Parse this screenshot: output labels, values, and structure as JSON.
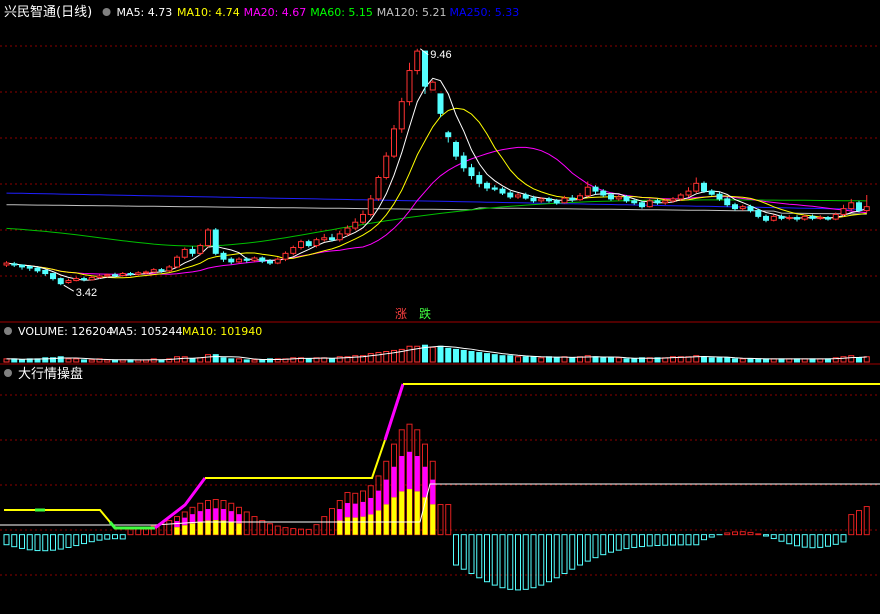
{
  "header": {
    "stock_name": "兴民智通",
    "period": "(日线)",
    "ma_values": [
      {
        "label": "MA5: 4.73",
        "color": "#ffffff"
      },
      {
        "label": "MA10: 4.74",
        "color": "#ffff00"
      },
      {
        "label": "MA20: 4.67",
        "color": "#ff00ff"
      },
      {
        "label": "MA60: 5.15",
        "color": "#00ff00"
      },
      {
        "label": "MA120: 5.21",
        "color": "#c0c0c0"
      },
      {
        "label": "MA250: 5.33",
        "color": "#0000ff"
      }
    ]
  },
  "volume_header": {
    "items": [
      {
        "label": "VOLUME: 126204",
        "color": "#ffffff"
      },
      {
        "label": "MA5: 105244",
        "color": "#ffffff"
      },
      {
        "label": "MA10: 101940",
        "color": "#ffff00"
      }
    ]
  },
  "indicator_header": {
    "title": "大行情操盘"
  },
  "badges": {
    "up": "涨",
    "down": "跌"
  },
  "annotations": {
    "high": "9.46",
    "low": "3.42"
  },
  "colors": {
    "up": "#ff3232",
    "down": "#54ffff",
    "ma5": "#ffffff",
    "ma10": "#ffff00",
    "ma20": "#ff00ff",
    "ma60": "#00c000",
    "ma120": "#c0c0c0",
    "ma250": "#2020ff",
    "grid": "#8b0000"
  },
  "chart_data": {
    "type": "candlestick",
    "price_range": [
      3.0,
      10.2
    ],
    "candles": [
      [
        3.9,
        3.95,
        3.85,
        4.0
      ],
      [
        3.93,
        3.9,
        3.85,
        3.98
      ],
      [
        3.9,
        3.85,
        3.78,
        3.92
      ],
      [
        3.86,
        3.82,
        3.75,
        3.88
      ],
      [
        3.82,
        3.75,
        3.7,
        3.85
      ],
      [
        3.76,
        3.68,
        3.62,
        3.78
      ],
      [
        3.68,
        3.55,
        3.5,
        3.7
      ],
      [
        3.55,
        3.42,
        3.38,
        3.58
      ],
      [
        3.45,
        3.5,
        3.42,
        3.55
      ],
      [
        3.5,
        3.55,
        3.48,
        3.6
      ],
      [
        3.55,
        3.52,
        3.48,
        3.6
      ],
      [
        3.52,
        3.58,
        3.5,
        3.62
      ],
      [
        3.58,
        3.62,
        3.55,
        3.66
      ],
      [
        3.62,
        3.65,
        3.58,
        3.68
      ],
      [
        3.65,
        3.63,
        3.58,
        3.7
      ],
      [
        3.63,
        3.68,
        3.6,
        3.72
      ],
      [
        3.68,
        3.66,
        3.62,
        3.72
      ],
      [
        3.66,
        3.7,
        3.63,
        3.74
      ],
      [
        3.7,
        3.72,
        3.66,
        3.76
      ],
      [
        3.72,
        3.78,
        3.7,
        3.82
      ],
      [
        3.78,
        3.75,
        3.7,
        3.82
      ],
      [
        3.75,
        3.85,
        3.72,
        3.9
      ],
      [
        3.85,
        4.1,
        3.82,
        4.15
      ],
      [
        4.1,
        4.3,
        4.05,
        4.35
      ],
      [
        4.3,
        4.2,
        4.12,
        4.38
      ],
      [
        4.2,
        4.4,
        4.15,
        4.45
      ],
      [
        4.4,
        4.8,
        4.35,
        4.85
      ],
      [
        4.8,
        4.2,
        4.15,
        4.85
      ],
      [
        4.2,
        4.05,
        3.98,
        4.25
      ],
      [
        4.05,
        3.98,
        3.92,
        4.1
      ],
      [
        3.98,
        4.05,
        3.95,
        4.1
      ],
      [
        4.05,
        4.02,
        3.96,
        4.1
      ],
      [
        4.02,
        4.08,
        3.98,
        4.12
      ],
      [
        4.08,
        4.0,
        3.95,
        4.12
      ],
      [
        4.0,
        3.95,
        3.9,
        4.05
      ],
      [
        3.95,
        4.05,
        3.92,
        4.1
      ],
      [
        4.05,
        4.2,
        4.0,
        4.25
      ],
      [
        4.2,
        4.35,
        4.15,
        4.4
      ],
      [
        4.35,
        4.5,
        4.3,
        4.55
      ],
      [
        4.5,
        4.4,
        4.35,
        4.55
      ],
      [
        4.4,
        4.55,
        4.35,
        4.6
      ],
      [
        4.55,
        4.6,
        4.5,
        4.7
      ],
      [
        4.6,
        4.55,
        4.5,
        4.7
      ],
      [
        4.55,
        4.7,
        4.5,
        4.78
      ],
      [
        4.7,
        4.85,
        4.65,
        4.92
      ],
      [
        4.85,
        5.0,
        4.8,
        5.1
      ],
      [
        5.0,
        5.2,
        4.95,
        5.3
      ],
      [
        5.2,
        5.6,
        5.15,
        5.7
      ],
      [
        5.6,
        6.15,
        5.55,
        6.2
      ],
      [
        6.15,
        6.7,
        6.1,
        6.8
      ],
      [
        6.7,
        7.4,
        6.65,
        7.5
      ],
      [
        7.4,
        8.1,
        7.3,
        8.2
      ],
      [
        8.1,
        8.9,
        8.0,
        9.1
      ],
      [
        8.9,
        9.4,
        8.8,
        9.46
      ],
      [
        9.4,
        8.5,
        8.3,
        9.4
      ],
      [
        8.4,
        8.6,
        8.4,
        8.65
      ],
      [
        8.3,
        7.8,
        7.7,
        8.0
      ],
      [
        7.3,
        7.2,
        7.05,
        7.35
      ],
      [
        7.05,
        6.7,
        6.6,
        7.1
      ],
      [
        6.7,
        6.4,
        6.3,
        6.8
      ],
      [
        6.4,
        6.2,
        6.1,
        6.5
      ],
      [
        6.2,
        6.0,
        5.9,
        6.3
      ],
      [
        6.0,
        5.88,
        5.8,
        6.05
      ],
      [
        5.88,
        5.85,
        5.8,
        5.95
      ],
      [
        5.85,
        5.75,
        5.7,
        5.9
      ],
      [
        5.75,
        5.65,
        5.6,
        5.8
      ],
      [
        5.65,
        5.7,
        5.6,
        5.75
      ],
      [
        5.7,
        5.62,
        5.58,
        5.76
      ],
      [
        5.62,
        5.55,
        5.5,
        5.68
      ],
      [
        5.55,
        5.6,
        5.5,
        5.65
      ],
      [
        5.6,
        5.55,
        5.5,
        5.65
      ],
      [
        5.55,
        5.5,
        5.45,
        5.6
      ],
      [
        5.5,
        5.62,
        5.48,
        5.68
      ],
      [
        5.62,
        5.58,
        5.52,
        5.7
      ],
      [
        5.58,
        5.68,
        5.55,
        5.75
      ],
      [
        5.68,
        5.9,
        5.65,
        6.05
      ],
      [
        5.9,
        5.8,
        5.72,
        5.95
      ],
      [
        5.8,
        5.7,
        5.65,
        5.85
      ],
      [
        5.7,
        5.6,
        5.55,
        5.75
      ],
      [
        5.6,
        5.65,
        5.55,
        5.7
      ],
      [
        5.65,
        5.55,
        5.5,
        5.7
      ],
      [
        5.55,
        5.5,
        5.45,
        5.6
      ],
      [
        5.5,
        5.4,
        5.35,
        5.55
      ],
      [
        5.4,
        5.55,
        5.38,
        5.6
      ],
      [
        5.55,
        5.5,
        5.45,
        5.6
      ],
      [
        5.5,
        5.55,
        5.45,
        5.62
      ],
      [
        5.55,
        5.6,
        5.5,
        5.65
      ],
      [
        5.6,
        5.7,
        5.55,
        5.75
      ],
      [
        5.7,
        5.8,
        5.65,
        5.9
      ],
      [
        5.8,
        6.0,
        5.75,
        6.15
      ],
      [
        6.0,
        5.8,
        5.75,
        6.05
      ],
      [
        5.8,
        5.72,
        5.68,
        5.85
      ],
      [
        5.72,
        5.6,
        5.55,
        5.78
      ],
      [
        5.6,
        5.45,
        5.4,
        5.65
      ],
      [
        5.45,
        5.35,
        5.3,
        5.5
      ],
      [
        5.35,
        5.4,
        5.3,
        5.45
      ],
      [
        5.4,
        5.3,
        5.25,
        5.45
      ],
      [
        5.3,
        5.15,
        5.1,
        5.35
      ],
      [
        5.15,
        5.05,
        5.0,
        5.2
      ],
      [
        5.05,
        5.15,
        5.02,
        5.2
      ],
      [
        5.15,
        5.1,
        5.05,
        5.2
      ],
      [
        5.1,
        5.12,
        5.05,
        5.18
      ],
      [
        5.12,
        5.08,
        5.02,
        5.18
      ],
      [
        5.08,
        5.15,
        5.04,
        5.2
      ],
      [
        5.15,
        5.1,
        5.05,
        5.2
      ],
      [
        5.1,
        5.12,
        5.06,
        5.18
      ],
      [
        5.12,
        5.08,
        5.04,
        5.16
      ],
      [
        5.08,
        5.2,
        5.05,
        5.25
      ],
      [
        5.2,
        5.35,
        5.15,
        5.45
      ],
      [
        5.35,
        5.5,
        5.3,
        5.6
      ],
      [
        5.5,
        5.3,
        5.25,
        5.55
      ],
      [
        5.3,
        5.4,
        5.25,
        5.7
      ]
    ],
    "volume": [
      3,
      3,
      2,
      3,
      3,
      4,
      4,
      5,
      3,
      3,
      2,
      2,
      3,
      2,
      2,
      2,
      2,
      2,
      2,
      3,
      2,
      3,
      5,
      5,
      3,
      4,
      7,
      7,
      4,
      3,
      3,
      2,
      2,
      2,
      3,
      3,
      3,
      4,
      4,
      3,
      4,
      4,
      3,
      5,
      5,
      6,
      6,
      8,
      9,
      10,
      11,
      12,
      15,
      15,
      16,
      14,
      15,
      13,
      12,
      11,
      10,
      9,
      8,
      7,
      6,
      6,
      5,
      5,
      5,
      4,
      5,
      4,
      5,
      4,
      5,
      6,
      5,
      4,
      4,
      4,
      3,
      3,
      4,
      4,
      4,
      4,
      5,
      5,
      5,
      6,
      5,
      4,
      4,
      4,
      3,
      3,
      3,
      3,
      3,
      3,
      3,
      3,
      3,
      3,
      3,
      3,
      3,
      4,
      5,
      6,
      4,
      5
    ],
    "indicator_range": [
      -75,
      150
    ]
  }
}
